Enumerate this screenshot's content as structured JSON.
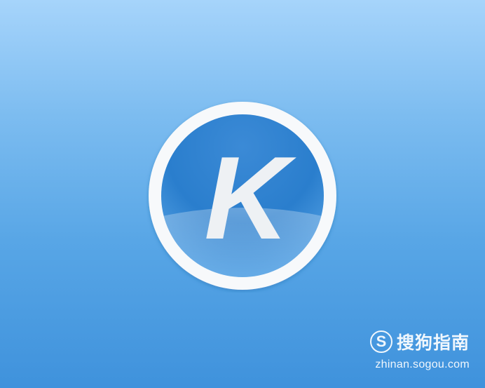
{
  "logo": {
    "letter": "K",
    "icon": "kugou-music-logo-icon",
    "colors": {
      "ring": "#f7f9fb",
      "disc_light": "#5aa6e6",
      "disc_dark": "#2478c8",
      "letter": "#eef1f4"
    }
  },
  "watermark": {
    "badge_letter": "S",
    "icon": "sogou-s-icon",
    "name": "搜狗指南",
    "url": "zhinan.sogou.com"
  },
  "colors": {
    "background_top": "#a6d4fb",
    "background_bottom": "#3f92dc"
  }
}
